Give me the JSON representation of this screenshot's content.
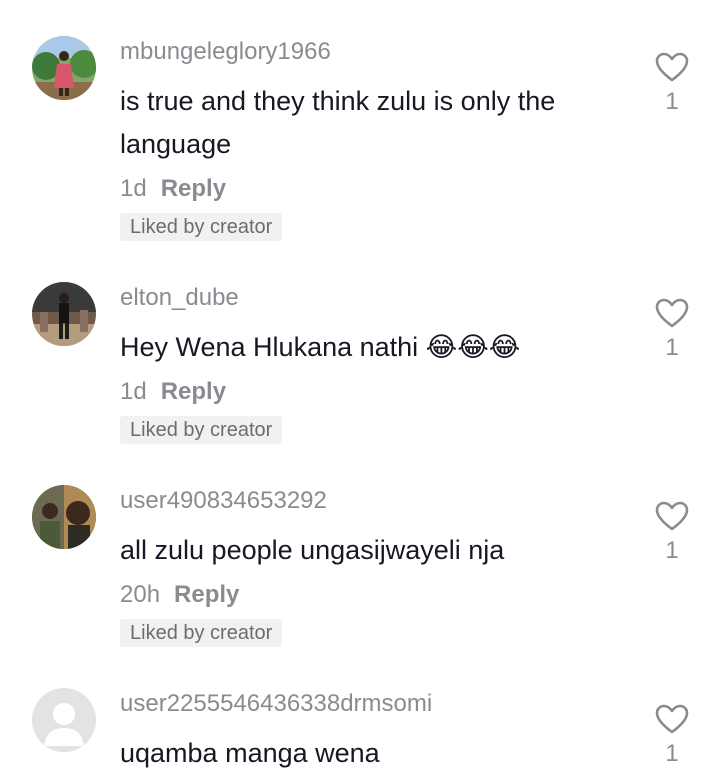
{
  "comments": [
    {
      "username": "mbungeleglory1966",
      "text": "is true and they think zulu is only the language",
      "time": "1d",
      "reply_label": "Reply",
      "badge": "Liked by creator",
      "likes": "1",
      "avatar_icon": "user-photo-avatar",
      "liked": false
    },
    {
      "username": "elton_dube",
      "text": "Hey Wena Hlukana nathi 😂😂😂",
      "time": "1d",
      "reply_label": "Reply",
      "badge": "Liked by creator",
      "likes": "1",
      "avatar_icon": "user-photo-avatar",
      "liked": false
    },
    {
      "username": "user490834653292",
      "text": "all zulu people ungasijwayeli nja",
      "time": "20h",
      "reply_label": "Reply",
      "badge": "Liked by creator",
      "likes": "1",
      "avatar_icon": "user-photo-avatar",
      "liked": false
    },
    {
      "username": "user2255546436338drmsomi",
      "text": "uqamba manga wena",
      "time": "",
      "reply_label": "",
      "badge": "",
      "likes": "1",
      "avatar_icon": "default-avatar",
      "liked": false
    }
  ],
  "colors": {
    "username": "#8a8b91",
    "text": "#161823",
    "badge_bg": "#f1f1f2",
    "heart": "#8a8b91"
  }
}
